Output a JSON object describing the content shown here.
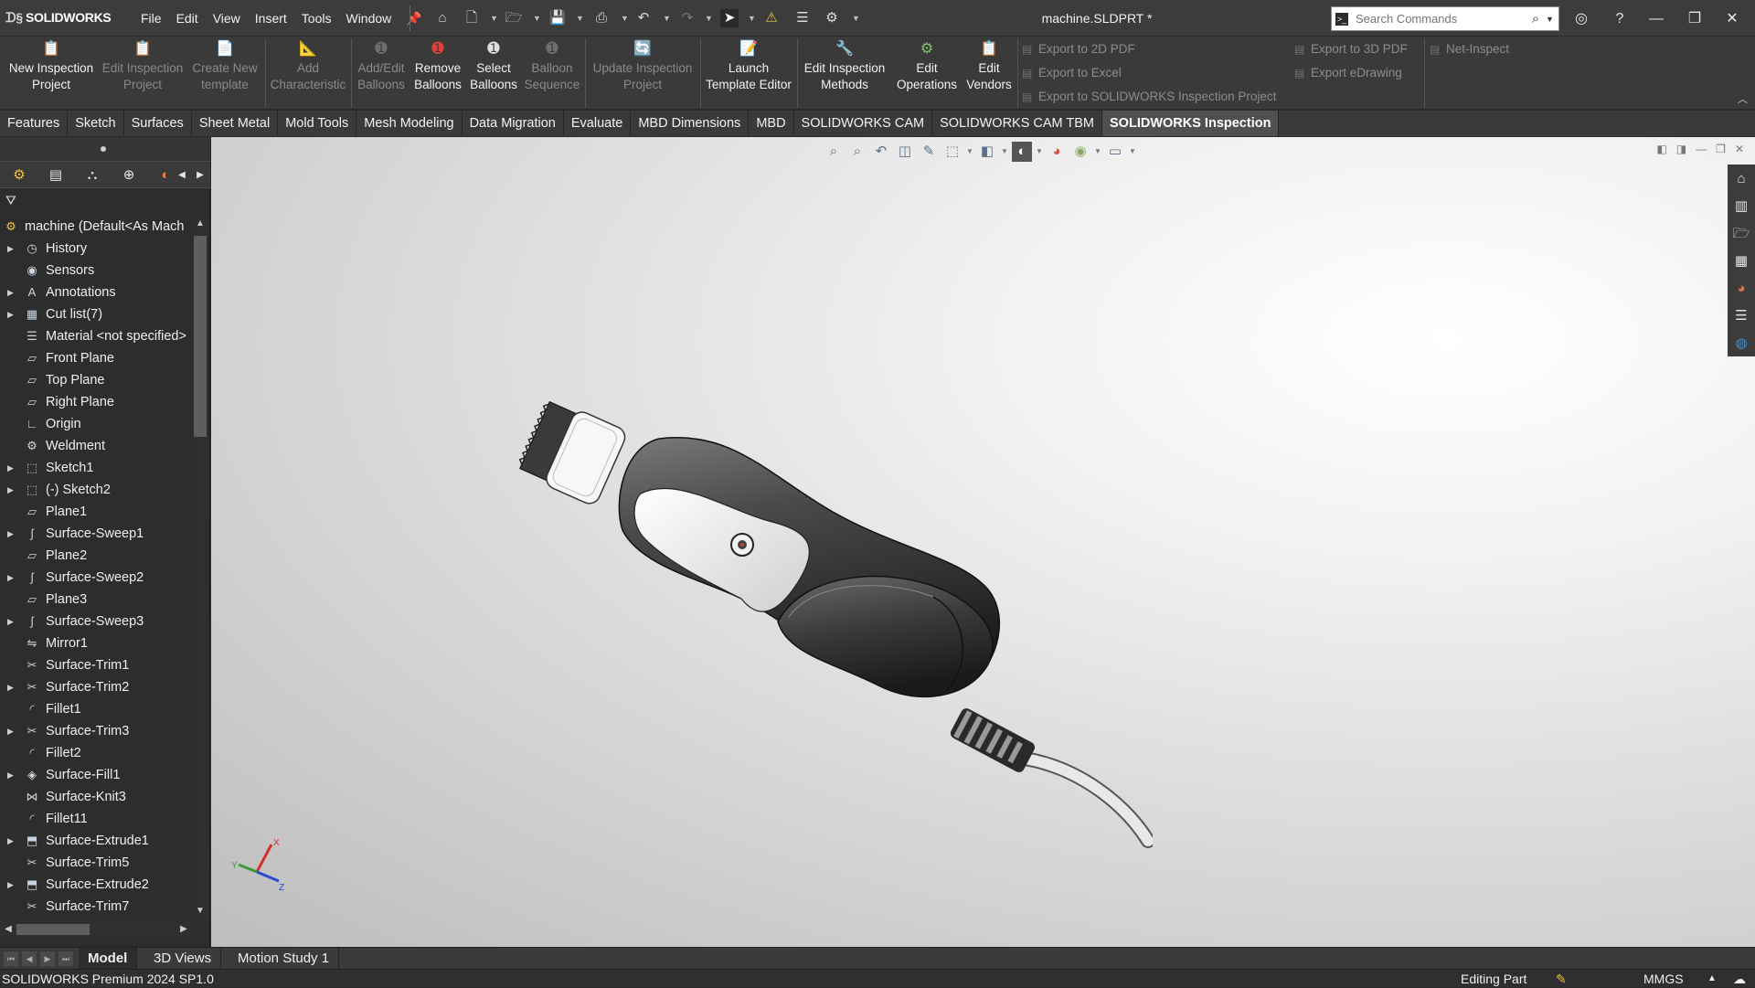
{
  "app": {
    "brand": "SOLIDWORKS",
    "document_title": "machine.SLDPRT *"
  },
  "menus": [
    "File",
    "Edit",
    "View",
    "Insert",
    "Tools",
    "Window"
  ],
  "search": {
    "placeholder": "Search Commands"
  },
  "ribbon": {
    "buttons": [
      {
        "line1": "New Inspection",
        "line2": "Project",
        "enabled": true
      },
      {
        "line1": "Edit Inspection",
        "line2": "Project",
        "enabled": false
      },
      {
        "line1": "Create New",
        "line2": "template",
        "enabled": false
      },
      {
        "line1": "Add",
        "line2": "Characteristic",
        "enabled": false
      },
      {
        "line1": "Add/Edit",
        "line2": "Balloons",
        "enabled": false
      },
      {
        "line1": "Remove",
        "line2": "Balloons",
        "enabled": true
      },
      {
        "line1": "Select",
        "line2": "Balloons",
        "enabled": true
      },
      {
        "line1": "Balloon",
        "line2": "Sequence",
        "enabled": false
      },
      {
        "line1": "Update Inspection",
        "line2": "Project",
        "enabled": false
      },
      {
        "line1": "Launch",
        "line2": "Template Editor",
        "enabled": true
      },
      {
        "line1": "Edit Inspection",
        "line2": "Methods",
        "enabled": true
      },
      {
        "line1": "Edit",
        "line2": "Operations",
        "enabled": true
      },
      {
        "line1": "Edit",
        "line2": "Vendors",
        "enabled": true
      }
    ],
    "exports": {
      "pdf2d": "Export to 2D PDF",
      "excel": "Export to Excel",
      "sw_inspection": "Export to SOLIDWORKS Inspection Project",
      "pdf3d": "Export to 3D PDF",
      "edrawing": "Export eDrawing",
      "net_inspect": "Net-Inspect"
    }
  },
  "tabs": [
    {
      "label": "Features",
      "active": false
    },
    {
      "label": "Sketch",
      "active": false
    },
    {
      "label": "Surfaces",
      "active": false
    },
    {
      "label": "Sheet Metal",
      "active": false
    },
    {
      "label": "Mold Tools",
      "active": false
    },
    {
      "label": "Mesh Modeling",
      "active": false
    },
    {
      "label": "Data Migration",
      "active": false
    },
    {
      "label": "Evaluate",
      "active": false
    },
    {
      "label": "MBD Dimensions",
      "active": false
    },
    {
      "label": "MBD",
      "active": false
    },
    {
      "label": "SOLIDWORKS CAM",
      "active": false
    },
    {
      "label": "SOLIDWORKS CAM TBM",
      "active": false
    },
    {
      "label": "SOLIDWORKS Inspection",
      "active": true
    }
  ],
  "tree": [
    {
      "label": "machine (Default<As Mach",
      "icon": "part-icon",
      "expand": false,
      "root": true
    },
    {
      "label": "History",
      "icon": "history-icon",
      "expand": true
    },
    {
      "label": "Sensors",
      "icon": "sensor-icon",
      "expand": false
    },
    {
      "label": "Annotations",
      "icon": "annotations-icon",
      "expand": true
    },
    {
      "label": "Cut list(7)",
      "icon": "cutlist-icon",
      "expand": true
    },
    {
      "label": "Material <not specified>",
      "icon": "material-icon",
      "expand": false
    },
    {
      "label": "Front Plane",
      "icon": "plane-icon",
      "expand": false
    },
    {
      "label": "Top Plane",
      "icon": "plane-icon",
      "expand": false
    },
    {
      "label": "Right Plane",
      "icon": "plane-icon",
      "expand": false
    },
    {
      "label": "Origin",
      "icon": "origin-icon",
      "expand": false
    },
    {
      "label": "Weldment",
      "icon": "weldment-icon",
      "expand": false
    },
    {
      "label": "Sketch1",
      "icon": "sketch-icon",
      "expand": true
    },
    {
      "label": "(-) Sketch2",
      "icon": "sketch-icon",
      "expand": true
    },
    {
      "label": "Plane1",
      "icon": "plane-icon",
      "expand": false
    },
    {
      "label": "Surface-Sweep1",
      "icon": "sweep-icon",
      "expand": true
    },
    {
      "label": "Plane2",
      "icon": "plane-icon",
      "expand": false
    },
    {
      "label": "Surface-Sweep2",
      "icon": "sweep-icon",
      "expand": true
    },
    {
      "label": "Plane3",
      "icon": "plane-icon",
      "expand": false
    },
    {
      "label": "Surface-Sweep3",
      "icon": "sweep-icon",
      "expand": true
    },
    {
      "label": "Mirror1",
      "icon": "mirror-icon",
      "expand": false
    },
    {
      "label": "Surface-Trim1",
      "icon": "trim-icon",
      "expand": false
    },
    {
      "label": "Surface-Trim2",
      "icon": "trim-icon",
      "expand": true
    },
    {
      "label": "Fillet1",
      "icon": "fillet-icon",
      "expand": false
    },
    {
      "label": "Surface-Trim3",
      "icon": "trim-icon",
      "expand": true
    },
    {
      "label": "Fillet2",
      "icon": "fillet-icon",
      "expand": false
    },
    {
      "label": "Surface-Fill1",
      "icon": "fill-icon",
      "expand": true
    },
    {
      "label": "Surface-Knit3",
      "icon": "knit-icon",
      "expand": false
    },
    {
      "label": "Fillet11",
      "icon": "fillet-icon",
      "expand": false
    },
    {
      "label": "Surface-Extrude1",
      "icon": "extrude-icon",
      "expand": true
    },
    {
      "label": "Surface-Trim5",
      "icon": "trim-icon",
      "expand": false
    },
    {
      "label": "Surface-Extrude2",
      "icon": "extrude-icon",
      "expand": true
    },
    {
      "label": "Surface-Trim7",
      "icon": "trim-icon",
      "expand": false
    }
  ],
  "triad": {
    "x": "X",
    "y": "Y",
    "z": "Z"
  },
  "bottom_tabs": [
    {
      "label": "Model",
      "active": true
    },
    {
      "label": "3D Views",
      "active": false
    },
    {
      "label": "Motion Study 1",
      "active": false
    }
  ],
  "status": {
    "version": "SOLIDWORKS Premium 2024 SP1.0",
    "mode": "Editing Part",
    "units": "MMGS"
  },
  "colors": {
    "accent": "#3c3c3c",
    "active_tab": "#505050",
    "viewport": "#e6e6e6"
  }
}
